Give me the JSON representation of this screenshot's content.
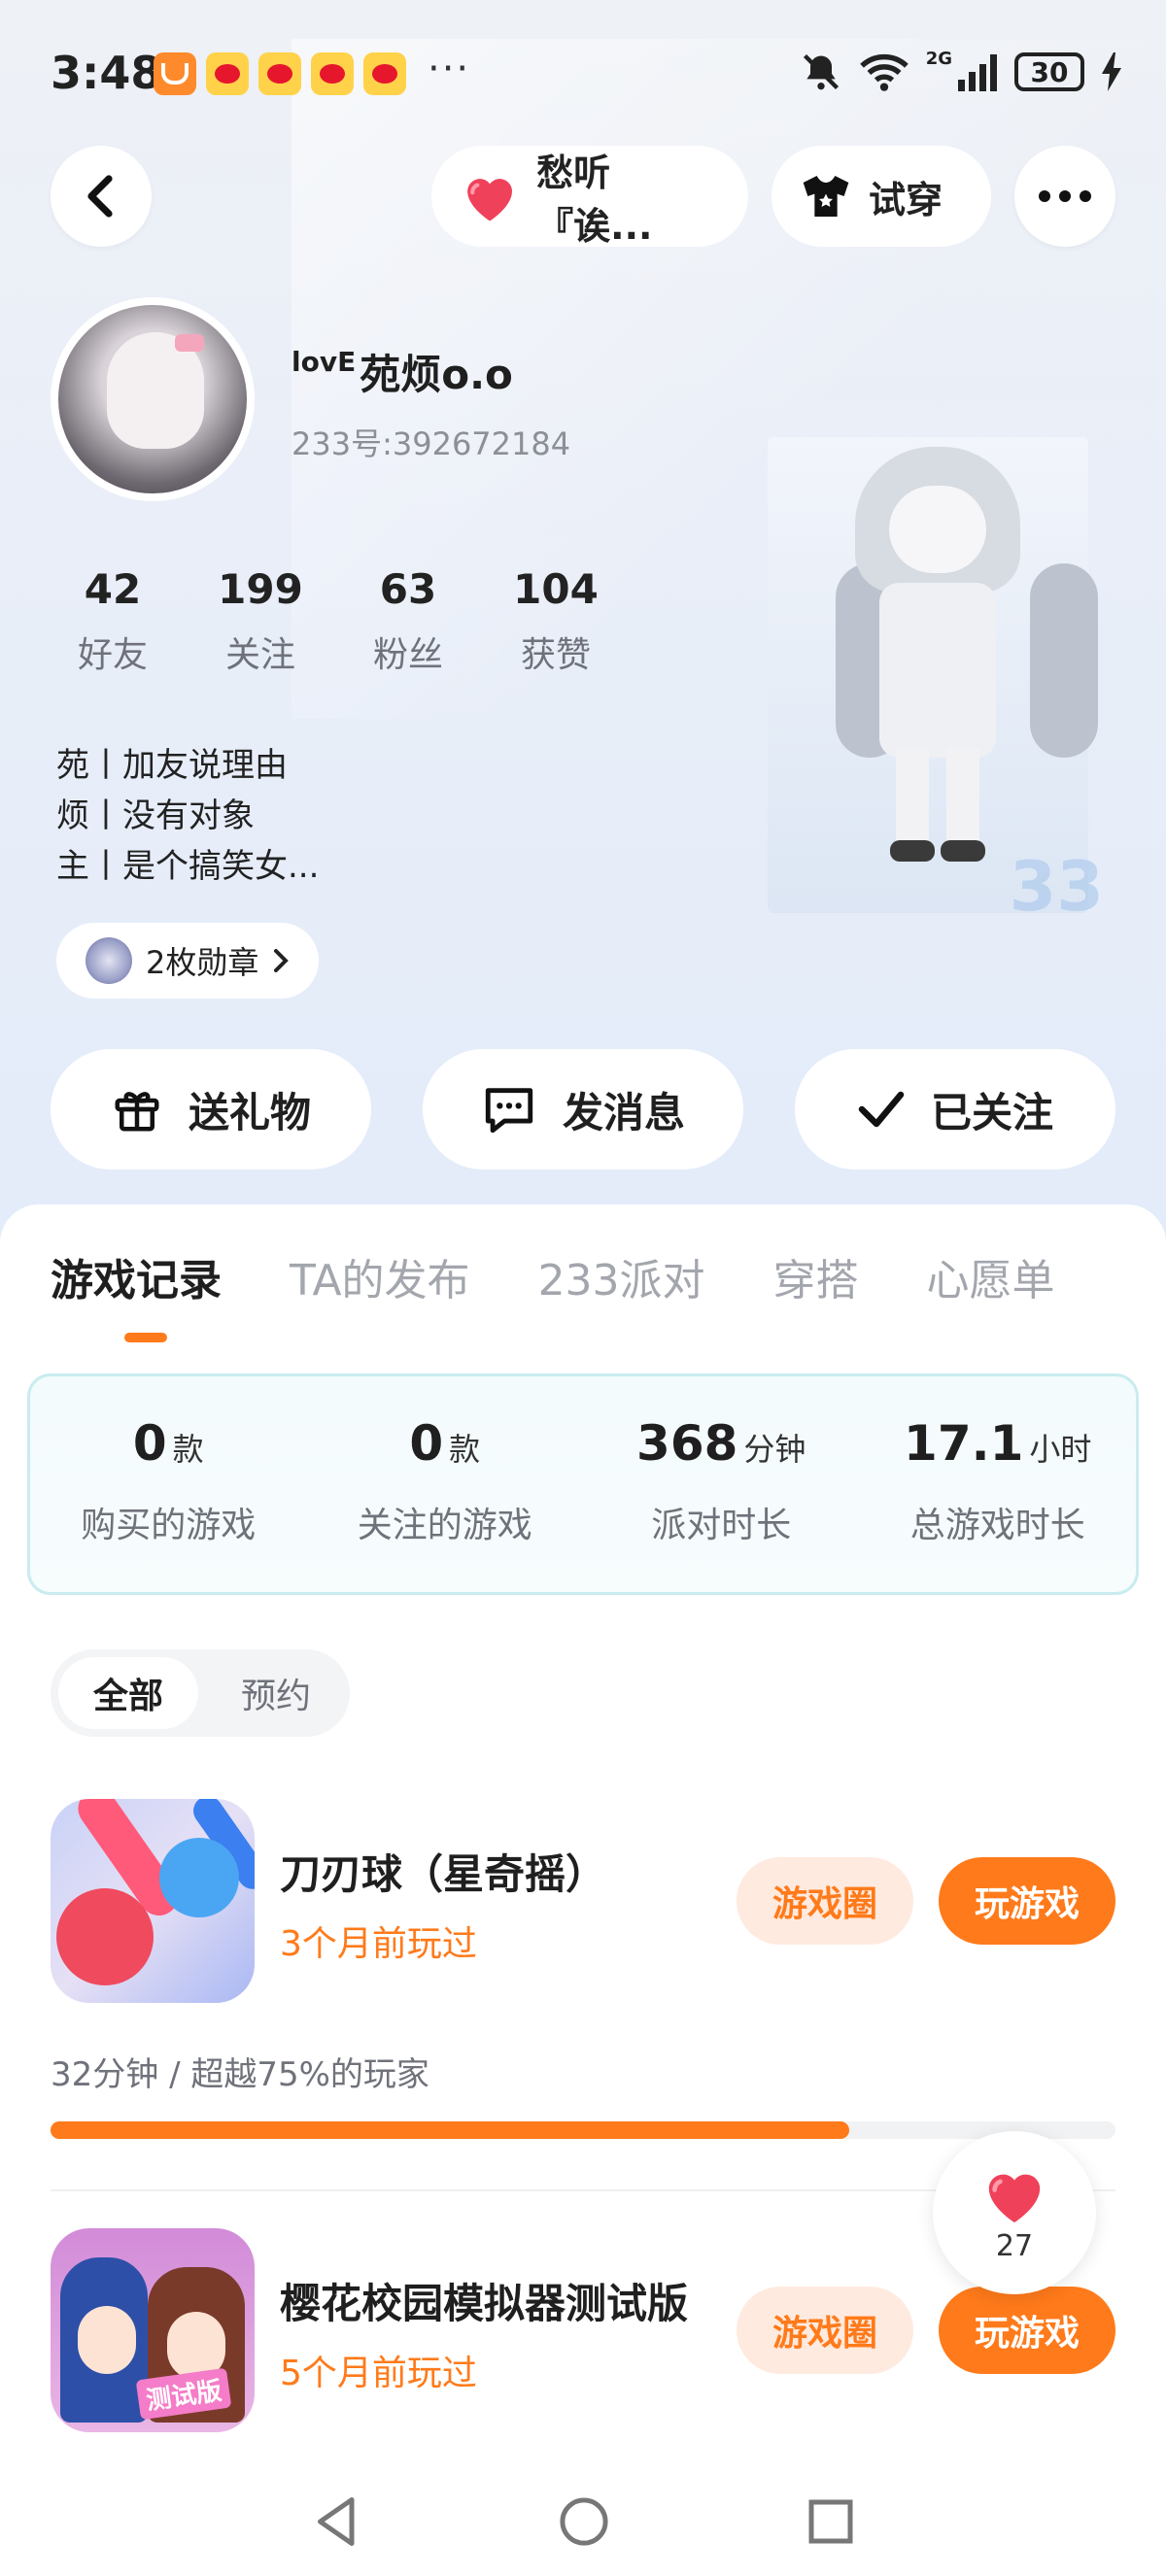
{
  "status_bar": {
    "time": "3:48",
    "more": "···",
    "network_label": "2G",
    "battery": "30"
  },
  "top_nav": {
    "song_label": "愁听『诶...",
    "try_on_label": "试穿"
  },
  "profile": {
    "name_prefix": "lovE",
    "name": "苑烦o.o",
    "user_id": "233号:392672184",
    "stats": [
      {
        "value": "42",
        "label": "好友"
      },
      {
        "value": "199",
        "label": "关注"
      },
      {
        "value": "63",
        "label": "粉丝"
      },
      {
        "value": "104",
        "label": "获赞"
      }
    ],
    "bio": [
      "苑丨加友说理由",
      "烦丨没有对象",
      "主丨是个搞笑女..."
    ],
    "medal_label": "2枚勋章",
    "figure_badge": "33"
  },
  "actions": {
    "gift": "送礼物",
    "message": "发消息",
    "following": "已关注"
  },
  "tabs": [
    "游戏记录",
    "TA的发布",
    "233派对",
    "穿搭",
    "心愿单"
  ],
  "summary": [
    {
      "value": "0",
      "unit": "款",
      "label": "购买的游戏"
    },
    {
      "value": "0",
      "unit": "款",
      "label": "关注的游戏"
    },
    {
      "value": "368",
      "unit": "分钟",
      "label": "派对时长"
    },
    {
      "value": "17.1",
      "unit": "小时",
      "label": "总游戏时长"
    }
  ],
  "filter": {
    "all": "全部",
    "reserve": "预约"
  },
  "games": [
    {
      "title": "刀刃球（星奇摇）",
      "last_played": "3个月前玩过",
      "circle_label": "游戏圈",
      "play_label": "玩游戏",
      "playtime": "32分钟 / 超越75%的玩家",
      "progress": 0.75
    },
    {
      "title": "樱花校园模拟器测试版",
      "last_played": "5个月前玩过",
      "circle_label": "游戏圈",
      "play_label": "玩游戏",
      "icon_label": "测试版"
    }
  ],
  "like_float": {
    "count": "27"
  },
  "colors": {
    "accent": "#ff7a1a",
    "accent_light": "#ffeadf",
    "heart": "#f0415a"
  }
}
